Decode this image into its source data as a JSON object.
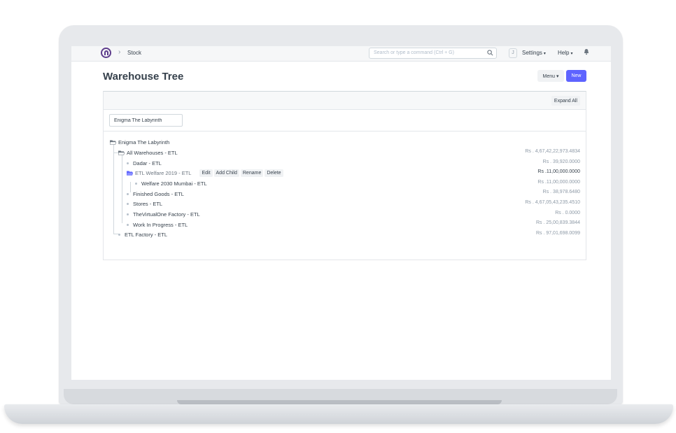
{
  "navbar": {
    "breadcrumb": "Stock",
    "search_placeholder": "Search or type a command (Ctrl + G)",
    "avatar_initial": "J",
    "settings_label": "Settings",
    "help_label": "Help"
  },
  "page": {
    "title": "Warehouse Tree",
    "menu_label": "Menu",
    "new_label": "New"
  },
  "toolbar": {
    "expand_all_label": "Expand All"
  },
  "filter": {
    "company_value": "Enigma The Labyrinth"
  },
  "tree": {
    "root": "Enigma The Labyrinth",
    "nodes": [
      {
        "label": "All Warehouses - ETL",
        "balance": "Rs . 4,67,42,22,973.4834"
      },
      {
        "label": "Dadar - ETL",
        "balance": "Rs . 39,920.0000"
      },
      {
        "label": "ETL Welfare 2019 - ETL",
        "balance": "Rs .11,00,000.0000"
      },
      {
        "label": "Welfare 2030 Mumbai - ETL",
        "balance": "Rs .11,00,000.0000"
      },
      {
        "label": "Finished Goods - ETL",
        "balance": "Rs . 38,978.6480"
      },
      {
        "label": "Stores - ETL",
        "balance": "Rs . 4,67,05,43,235.4510"
      },
      {
        "label": "TheVirtualOne Factory - ETL",
        "balance": "Rs . 0.0000"
      },
      {
        "label": "Work In Progress - ETL",
        "balance": "Rs . 25,00,839.3844"
      },
      {
        "label": "ETL Factory - ETL",
        "balance": "Rs . 97,01,698.0099"
      }
    ],
    "actions": [
      "Edit",
      "Add Child",
      "Rename",
      "Delete"
    ]
  },
  "colors": {
    "primary": "#5e64ff",
    "logo": "#5e3d8c",
    "selected_folder": "#5e64ff"
  }
}
